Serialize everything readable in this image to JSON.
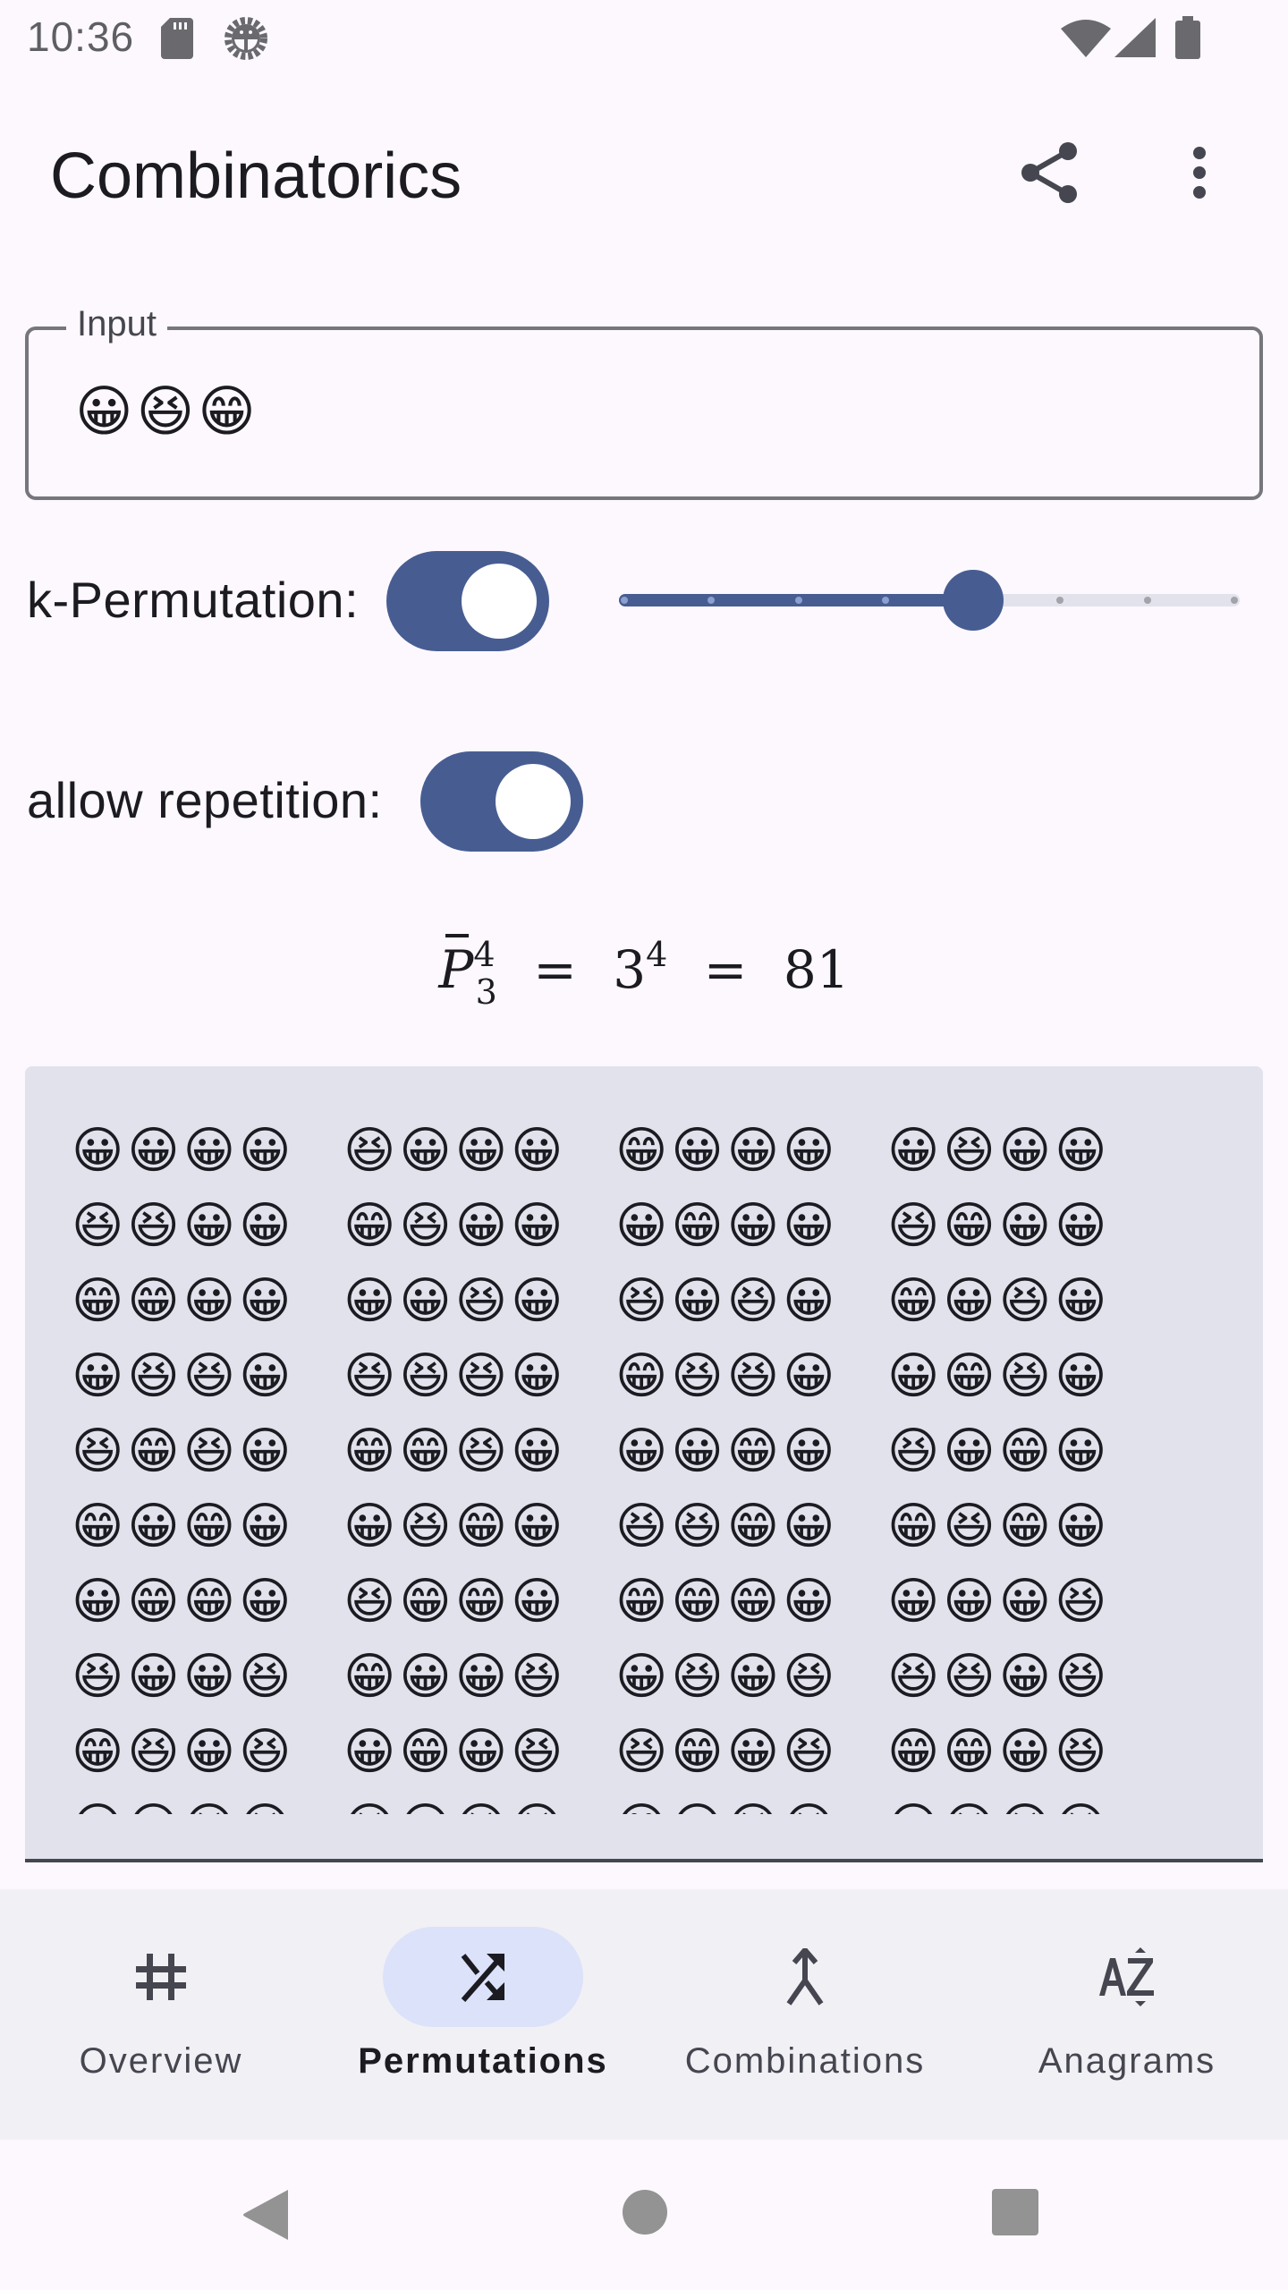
{
  "status_bar": {
    "time": "10:36",
    "icons": [
      "sd-card-icon",
      "debug-icon",
      "wifi-icon",
      "cell-signal-icon",
      "battery-icon"
    ]
  },
  "app_bar": {
    "title": "Combinatorics",
    "actions": [
      "share-icon",
      "more-vert-icon"
    ]
  },
  "input": {
    "label": "Input",
    "value": "😀😆😁"
  },
  "options": {
    "k_permutation": {
      "label": "k-Permutation:",
      "enabled": true
    },
    "k_slider": {
      "value": 4,
      "min": 0,
      "max": 7,
      "step": 1
    },
    "allow_repetition": {
      "label": "allow repetition:",
      "enabled": true
    }
  },
  "formula": {
    "symbol": "P",
    "superscript": "4",
    "subscript": "3",
    "eq1": "=",
    "base": "3",
    "exponent": "4",
    "eq2": "=",
    "result": "81"
  },
  "results": {
    "symbols": {
      "A": "😀",
      "B": "😆",
      "C": "😁"
    },
    "rows": [
      [
        "AAAA",
        "BAAA",
        "CAAA",
        "ABAA"
      ],
      [
        "BBAA",
        "CBAA",
        "ACAA",
        "BCAA"
      ],
      [
        "CCAA",
        "AABA",
        "BABA",
        "CABA"
      ],
      [
        "ABBA",
        "BBBA",
        "CBBA",
        "ACBA"
      ],
      [
        "BCBA",
        "CCBA",
        "AACA",
        "BACA"
      ],
      [
        "CACA",
        "ABCA",
        "BBCA",
        "CBCA"
      ],
      [
        "ACCA",
        "BCCA",
        "CCCA",
        "AAAB"
      ],
      [
        "BAAB",
        "CAAB",
        "ABAB",
        "BBAB"
      ],
      [
        "CBAB",
        "ACAB",
        "BCAB",
        "CCAB"
      ],
      [
        "AABB",
        "BABB",
        "CABB",
        "ABBB"
      ]
    ]
  },
  "bottom_nav": {
    "active_index": 1,
    "items": [
      {
        "label": "Overview",
        "icon": "tag-icon"
      },
      {
        "label": "Permutations",
        "icon": "shuffle-icon"
      },
      {
        "label": "Combinations",
        "icon": "merge-icon"
      },
      {
        "label": "Anagrams",
        "icon": "sort-by-alpha-icon"
      }
    ]
  },
  "colors": {
    "primary": "#475d92",
    "on_primary": "#ffffff",
    "track_inactive": "#e1e2ec",
    "nav_indicator": "#dce2f9",
    "results_background": "#e1e2ec",
    "surface": "#fcf8fd"
  }
}
